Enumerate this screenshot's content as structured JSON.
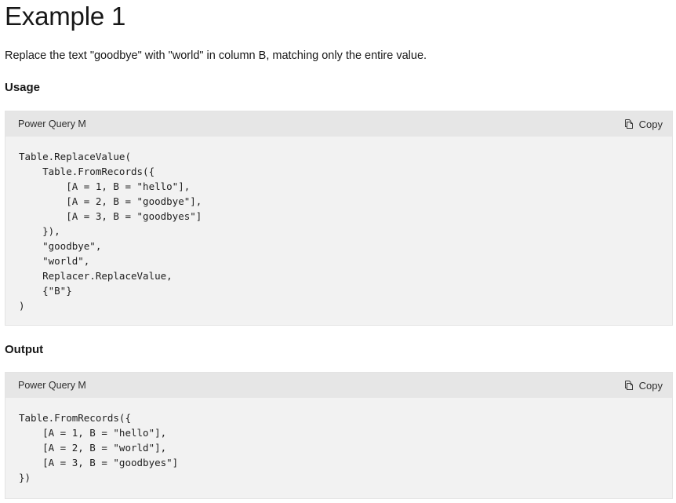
{
  "heading": "Example 1",
  "description": "Replace the text \"goodbye\" with \"world\" in column B, matching only the entire value.",
  "usage": {
    "label": "Usage",
    "code_block": {
      "language": "Power Query M",
      "copy_label": "Copy",
      "copy_icon": "copy-icon",
      "code": "Table.ReplaceValue(\n    Table.FromRecords({\n        [A = 1, B = \"hello\"],\n        [A = 2, B = \"goodbye\"],\n        [A = 3, B = \"goodbyes\"]\n    }),\n    \"goodbye\",\n    \"world\",\n    Replacer.ReplaceValue,\n    {\"B\"}\n)"
    }
  },
  "output": {
    "label": "Output",
    "code_block": {
      "language": "Power Query M",
      "copy_label": "Copy",
      "copy_icon": "copy-icon",
      "code": "Table.FromRecords({\n    [A = 1, B = \"hello\"],\n    [A = 2, B = \"world\"],\n    [A = 3, B = \"goodbyes\"]\n})"
    }
  }
}
